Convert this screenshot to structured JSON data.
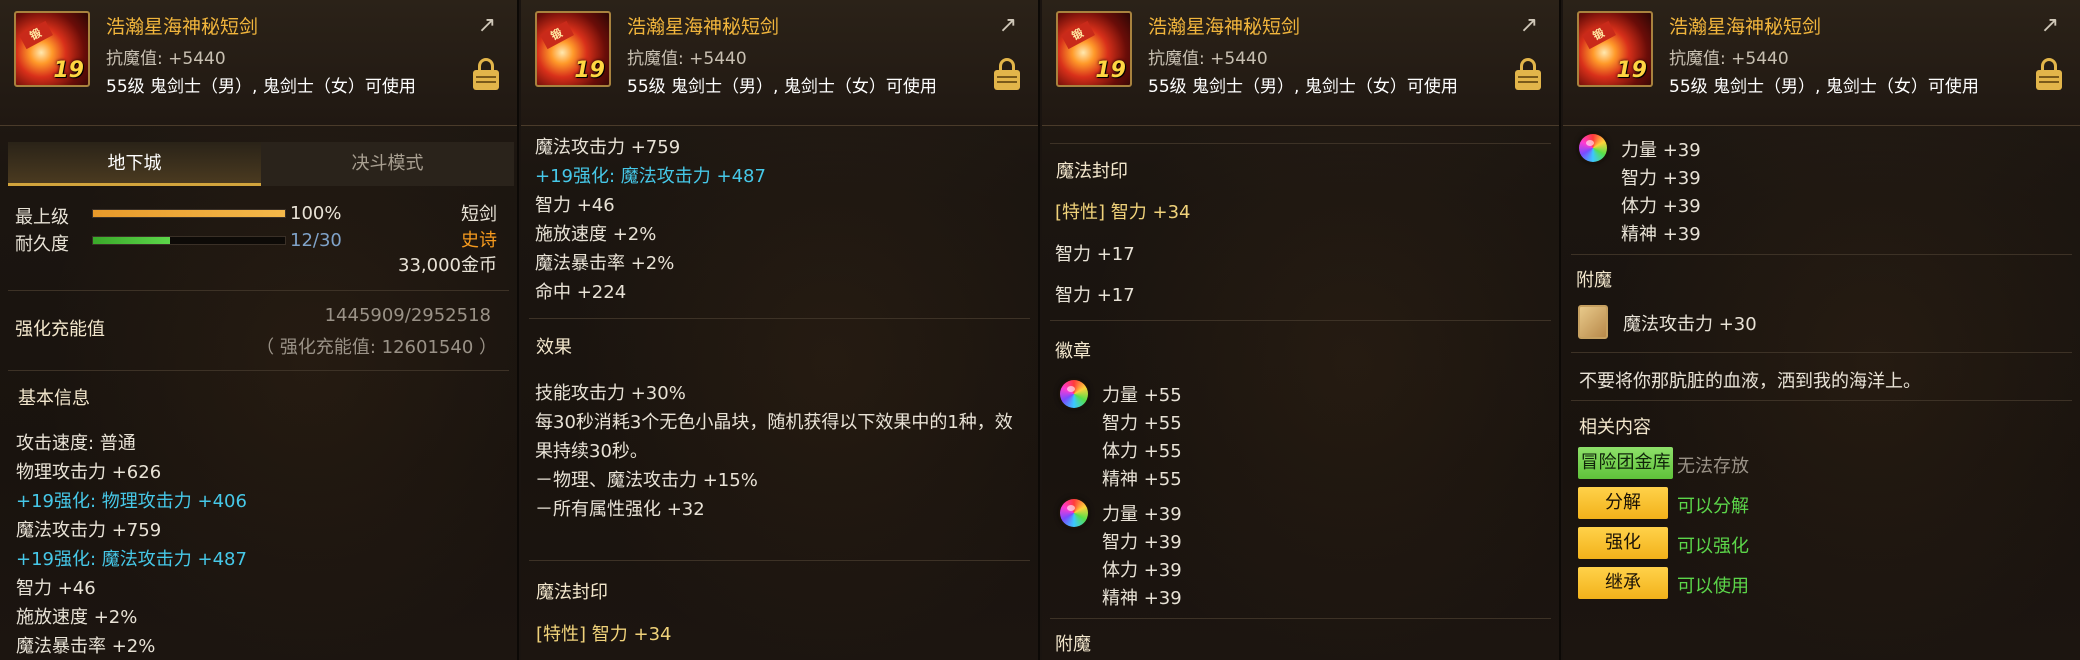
{
  "header": {
    "item_name": "浩瀚星海神秘短剑",
    "anti_magic": "抗魔值: +5440",
    "usable": "55级 鬼剑士（男）, 鬼剑士（女）可使用",
    "icon_tag": "锻",
    "icon_level": "19",
    "share_icon": "share-icon",
    "lock_icon": "lock-icon"
  },
  "panel1": {
    "tabs": [
      "地下城",
      "决斗模式"
    ],
    "grade_label": "最上级",
    "grade_value": "100%",
    "grade_fill": 1.0,
    "durability_label": "耐久度",
    "durability_value": "12/30",
    "durability_fill": 0.4,
    "weapon_type": "短剑",
    "rarity": "史诗",
    "price": "33,000金币",
    "charge_label": "强化充能值",
    "charge_value": "1445909/2952518",
    "charge_total": "（ 强化充能值: 12601540 ）",
    "basic_info": "基本信息",
    "stats": [
      {
        "text": "攻击速度: 普通",
        "color": "white"
      },
      {
        "text": "物理攻击力 +626",
        "color": "white"
      },
      {
        "text": "+19强化: 物理攻击力 +406",
        "color": "cyan"
      },
      {
        "text": "魔法攻击力 +759",
        "color": "white"
      },
      {
        "text": "+19强化: 魔法攻击力 +487",
        "color": "cyan"
      },
      {
        "text": "智力 +46",
        "color": "white"
      },
      {
        "text": "施放速度 +2%",
        "color": "white"
      },
      {
        "text": "魔法暴击率 +2%",
        "color": "white"
      }
    ]
  },
  "panel2": {
    "stats": [
      {
        "text": "魔法攻击力 +759",
        "color": "white"
      },
      {
        "text": "+19强化: 魔法攻击力 +487",
        "color": "cyan"
      },
      {
        "text": "智力 +46",
        "color": "white"
      },
      {
        "text": "施放速度 +2%",
        "color": "white"
      },
      {
        "text": "魔法暴击率 +2%",
        "color": "white"
      },
      {
        "text": "命中 +224",
        "color": "white"
      }
    ],
    "effect_title": "效果",
    "effects": [
      "技能攻击力 +30%",
      "每30秒消耗3个无色小晶块，随机获得以下效果中的1种，效",
      "果持续30秒。",
      "－物理、魔法攻击力 +15%",
      "－所有属性强化 +32"
    ],
    "seal_title": "魔法封印",
    "seal_trait": "[特性] 智力 +34"
  },
  "panel3": {
    "seal_title": "魔法封印",
    "seal_trait": "[特性] 智力 +34",
    "seal_lines": [
      "智力 +17",
      "智力 +17"
    ],
    "emblem_title": "徽章",
    "emblems": [
      [
        "力量 +55",
        "智力 +55",
        "体力 +55",
        "精神 +55"
      ],
      [
        "力量 +39",
        "智力 +39",
        "体力 +39",
        "精神 +39"
      ]
    ],
    "enchant_title": "附魔"
  },
  "panel4": {
    "emblem": [
      "力量 +39",
      "智力 +39",
      "体力 +39",
      "精神 +39"
    ],
    "enchant_title": "附魔",
    "enchant_value": "魔法攻击力 +30",
    "flavor": "不要将你那肮脏的血液，洒到我的海洋上。",
    "related_title": "相关内容",
    "related": [
      {
        "button": "冒险团金库",
        "value": "无法存放",
        "style": "green",
        "value_color": "gray"
      },
      {
        "button": "分解",
        "value": "可以分解",
        "style": "gold",
        "value_color": "green"
      },
      {
        "button": "强化",
        "value": "可以强化",
        "style": "gold",
        "value_color": "green"
      },
      {
        "button": "继承",
        "value": "可以使用",
        "style": "gold",
        "value_color": "green"
      }
    ]
  },
  "colors": {
    "name": "#f1b53c",
    "cyan": "#46c8e8",
    "orange": "#f59a1e",
    "green": "#5cd64a",
    "gold_button": "#f2b21a"
  }
}
